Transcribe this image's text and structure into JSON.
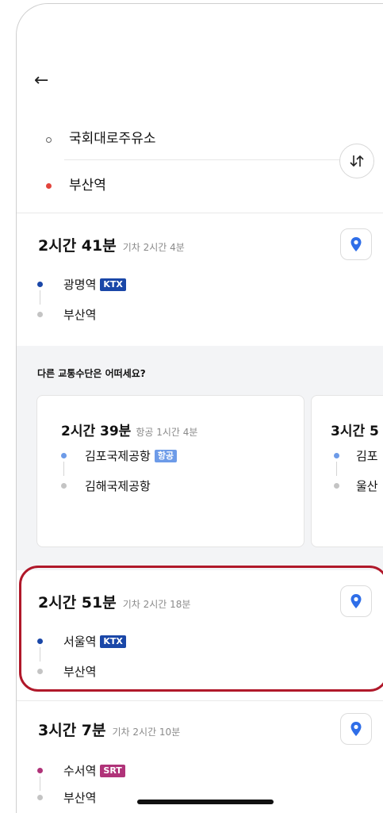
{
  "header": {
    "origin": "국회대로주유소",
    "destination": "부산역"
  },
  "routes": [
    {
      "duration": "2시간 41분",
      "detail": "기차 2시간 4분",
      "from": {
        "name": "광명역",
        "badge": "KTX",
        "badge_color": "#1a47a8"
      },
      "to": {
        "name": "부산역"
      }
    },
    {
      "duration": "2시간 51분",
      "detail": "기차 2시간 18분",
      "from": {
        "name": "서울역",
        "badge": "KTX",
        "badge_color": "#1a47a8"
      },
      "to": {
        "name": "부산역"
      }
    },
    {
      "duration": "3시간 7분",
      "detail": "기차 2시간 10분",
      "from": {
        "name": "수서역",
        "badge": "SRT",
        "badge_color": "#b03379"
      },
      "to": {
        "name": "부산역"
      }
    }
  ],
  "alternatives": {
    "heading": "다른 교통수단은 어떠세요?",
    "cards": [
      {
        "duration": "2시간 39분",
        "detail": "항공 1시간 4분",
        "from": {
          "name": "김포국제공항",
          "badge": "항공",
          "badge_color": "#6d9be8"
        },
        "to": {
          "name": "김해국제공항"
        }
      },
      {
        "duration": "3시간 5",
        "from": {
          "name": "김포"
        },
        "to": {
          "name": "울산"
        }
      }
    ]
  },
  "colors": {
    "ktx": "#1a47a8",
    "srt": "#b03379",
    "air": "#6d9be8",
    "pin": "#2f6ee8",
    "highlight": "#b0182a"
  }
}
